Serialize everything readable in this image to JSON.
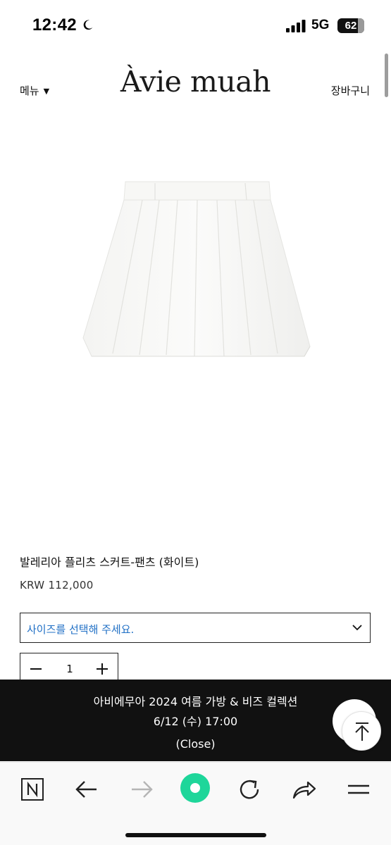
{
  "status_bar": {
    "time": "12:42",
    "network": "5G",
    "battery": "62",
    "icons": [
      "moon-icon",
      "signal-icon",
      "battery-icon"
    ]
  },
  "header": {
    "menu_label": "메뉴",
    "menu_caret": "▼",
    "logo": "Àvie muah",
    "cart_label": "장바구니"
  },
  "product": {
    "title": "발레리아 플리츠 스커트-팬츠 (화이트)",
    "price": "KRW 112,000",
    "size_select_placeholder": "사이즈를 선택해 주세요.",
    "quantity": "1"
  },
  "banner": {
    "line1": "아비에무아 2024 여름 가방 & 비즈 컬렉션",
    "line2": "6/12 (수) 17:00",
    "close": "(Close)"
  },
  "toolbar": {
    "items": [
      "naver-icon",
      "back-icon",
      "forward-icon",
      "home-icon",
      "refresh-icon",
      "share-icon",
      "menu-icon"
    ]
  },
  "colors": {
    "accent_blue": "#1f6fc5",
    "banner_bg": "#111111",
    "home_green": "#1ed69a"
  }
}
